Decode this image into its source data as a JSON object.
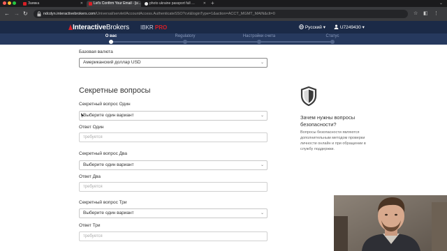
{
  "browser": {
    "tabs": [
      {
        "label": "Заявка",
        "active": false,
        "favicon_color": "#d81f26"
      },
      {
        "label": "Let's Confirm Your Email - [c…",
        "active": true,
        "favicon_color": "#d81f26"
      },
      {
        "label": "photo ukraine passport full …",
        "active": false,
        "favicon_color": "#e8e8e8"
      }
    ],
    "url_host": "ndcdyn.interactivebrokers.com",
    "url_path": "/Universal/servlet/AccountAccess.AuthenticateSSO?cvt&loginType=1&action=ACCT_MGMT_MAIN&clt=0"
  },
  "header": {
    "logo_bold": "Interactive",
    "logo_light": "Brokers",
    "product": "IBKR",
    "product_badge": "PRO",
    "language": "Русский",
    "username": "U7249430",
    "brand_color": "#d81f26"
  },
  "steps": {
    "items": [
      {
        "label": "О вас",
        "active": true
      },
      {
        "label": "Regulatory",
        "active": false
      },
      {
        "label": "Настройки счета",
        "active": false
      },
      {
        "label": "Статус",
        "active": false
      }
    ]
  },
  "form": {
    "base_currency": {
      "label": "Базовая валюта",
      "value": "Американский доллар USD"
    },
    "section_title": "Секретные вопросы",
    "questions": [
      {
        "label": "Секретный вопрос Один",
        "select_value": "Выберите один вариант",
        "answer_label": "Ответ Один",
        "answer_placeholder": "требуется"
      },
      {
        "label": "Секретный вопрос Два",
        "select_value": "Выберите один вариант",
        "answer_label": "Ответ Два",
        "answer_placeholder": "требуется"
      },
      {
        "label": "Секретный вопрос Три",
        "select_value": "Выберите один вариант",
        "answer_label": "Ответ Три",
        "answer_placeholder": "требуется"
      }
    ]
  },
  "sidebar": {
    "title": "Зачем нужны вопросы безопасности?",
    "body": "Вопросы безопасности являются дополнительным методом проверки личности онлайн и при обращении в службу поддержки."
  }
}
